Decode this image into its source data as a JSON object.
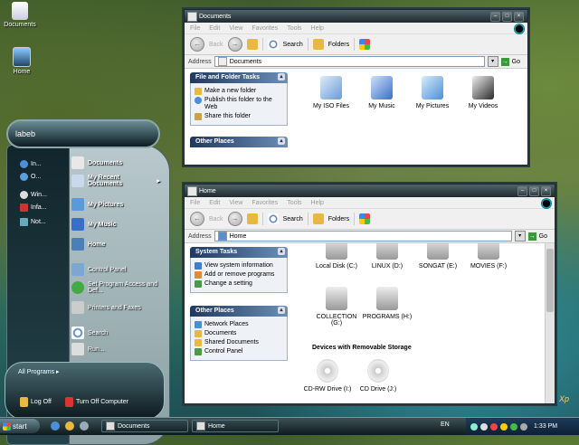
{
  "desktop": {
    "icons": [
      {
        "label": "Documents"
      },
      {
        "label": "Home"
      }
    ],
    "xp_badge": "Xp"
  },
  "documents_window": {
    "title": "Documents",
    "menu": [
      "File",
      "Edit",
      "View",
      "Favorites",
      "Tools",
      "Help"
    ],
    "toolbar": {
      "back": "Back",
      "search": "Search",
      "folders": "Folders"
    },
    "address_label": "Address",
    "address_value": "Documents",
    "go_label": "Go",
    "file_tasks": {
      "title": "File and Folder Tasks",
      "items": [
        "Make a new folder",
        "Publish this folder to the Web",
        "Share this folder"
      ]
    },
    "other_places": {
      "title": "Other Places"
    },
    "items": [
      {
        "label": "My ISO Files",
        "icon": "folder-icon",
        "color": "#6a9bd8"
      },
      {
        "label": "My Music",
        "icon": "music-folder-icon",
        "color": "#3a6fc8"
      },
      {
        "label": "My Pictures",
        "icon": "pictures-folder-icon",
        "color": "#4a8fd8"
      },
      {
        "label": "My Videos",
        "icon": "videos-folder-icon",
        "color": "#2a2a2a"
      }
    ]
  },
  "home_window": {
    "title": "Home",
    "menu": [
      "File",
      "Edit",
      "View",
      "Favorites",
      "Tools",
      "Help"
    ],
    "toolbar": {
      "back": "Back",
      "search": "Search",
      "folders": "Folders"
    },
    "address_label": "Address",
    "address_value": "Home",
    "go_label": "Go",
    "system_tasks": {
      "title": "System Tasks",
      "items": [
        "View system information",
        "Add or remove programs",
        "Change a setting"
      ]
    },
    "other_places": {
      "title": "Other Places",
      "items": [
        "Network Places",
        "Documents",
        "Shared Documents",
        "Control Panel"
      ]
    },
    "drives": [
      "Local Disk (C:)",
      "LINUX (D:)",
      "SONGAT (E:)",
      "MOVIES (F:)",
      "COLLECTION (G:)",
      "PROGRAMS (H:)"
    ],
    "removable_heading": "Devices with Removable Storage",
    "removable": [
      "CD-RW Drive (I:)",
      "CD Drive (J:)"
    ]
  },
  "start_menu": {
    "user_name": "labeb",
    "left_items": [
      "In...",
      "O...",
      "Win...",
      "Infa...",
      "Not..."
    ],
    "right_items": [
      {
        "label": "Documents",
        "bold": true
      },
      {
        "label": "My Recent Documents",
        "bold": true,
        "arrow": "▸"
      },
      {
        "label": "My Pictures",
        "bold": true
      },
      {
        "label": "My Music",
        "bold": true
      },
      {
        "label": "Home",
        "bold": true
      },
      {
        "label": "Control Panel",
        "bold": false
      },
      {
        "label": "Set Program Access and Def...",
        "bold": false
      },
      {
        "label": "Printers and Faxes",
        "bold": false
      },
      {
        "label": "Search",
        "bold": false
      },
      {
        "label": "Run...",
        "bold": false
      }
    ],
    "all_programs": "All Programs",
    "log_off": "Log Off",
    "turn_off": "Turn Off Computer"
  },
  "taskbar": {
    "start_label": "start",
    "buttons": [
      "Documents",
      "Home"
    ],
    "language": "EN",
    "clock": "1:33 PM"
  }
}
